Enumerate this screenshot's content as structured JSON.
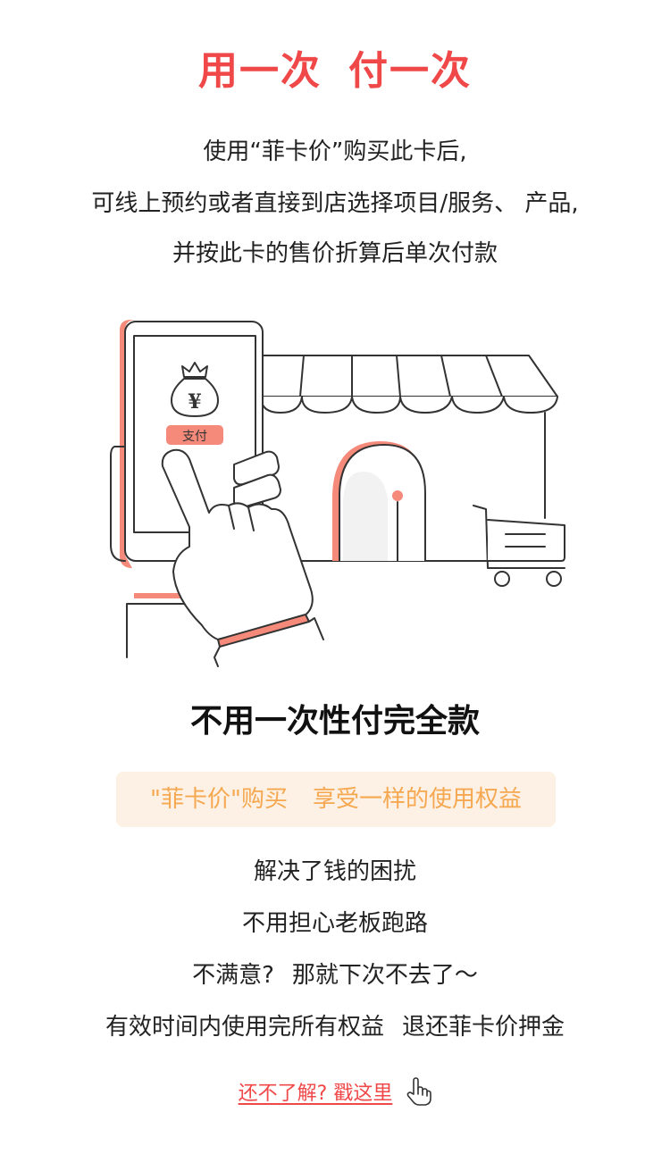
{
  "header": {
    "title_part1": "用一次",
    "title_part2": "付一次"
  },
  "intro": {
    "lines": [
      "使用“菲卡价”购买此卡后,",
      "可线上预约或者直接到店选择项目/服务、 产品,",
      "并按此卡的售价折算后单次付款"
    ]
  },
  "illustration": {
    "currency_symbol": "¥",
    "pay_label": "支付"
  },
  "section": {
    "subtitle": "不用一次性付完全款",
    "banner_part1": "\"菲卡价\"购买",
    "banner_part2": "享受一样的使用权益"
  },
  "benefits": {
    "line1": "解决了钱的困扰",
    "line2": "不用担心老板跑路",
    "line3_part1": "不满意?",
    "line3_part2": "那就下次不去了～",
    "line4_part1": "有效时间内使用完所有权益",
    "line4_part2": "退还菲卡价押金"
  },
  "footer": {
    "learn_more_label": "还不了解? 戳这里",
    "learn_more_icon": "hand-pointer-icon"
  },
  "colors": {
    "accent_red": "#f04848",
    "accent_salmon": "#f58a7a",
    "banner_bg": "#fdf0e4",
    "banner_text": "#f5a850"
  }
}
